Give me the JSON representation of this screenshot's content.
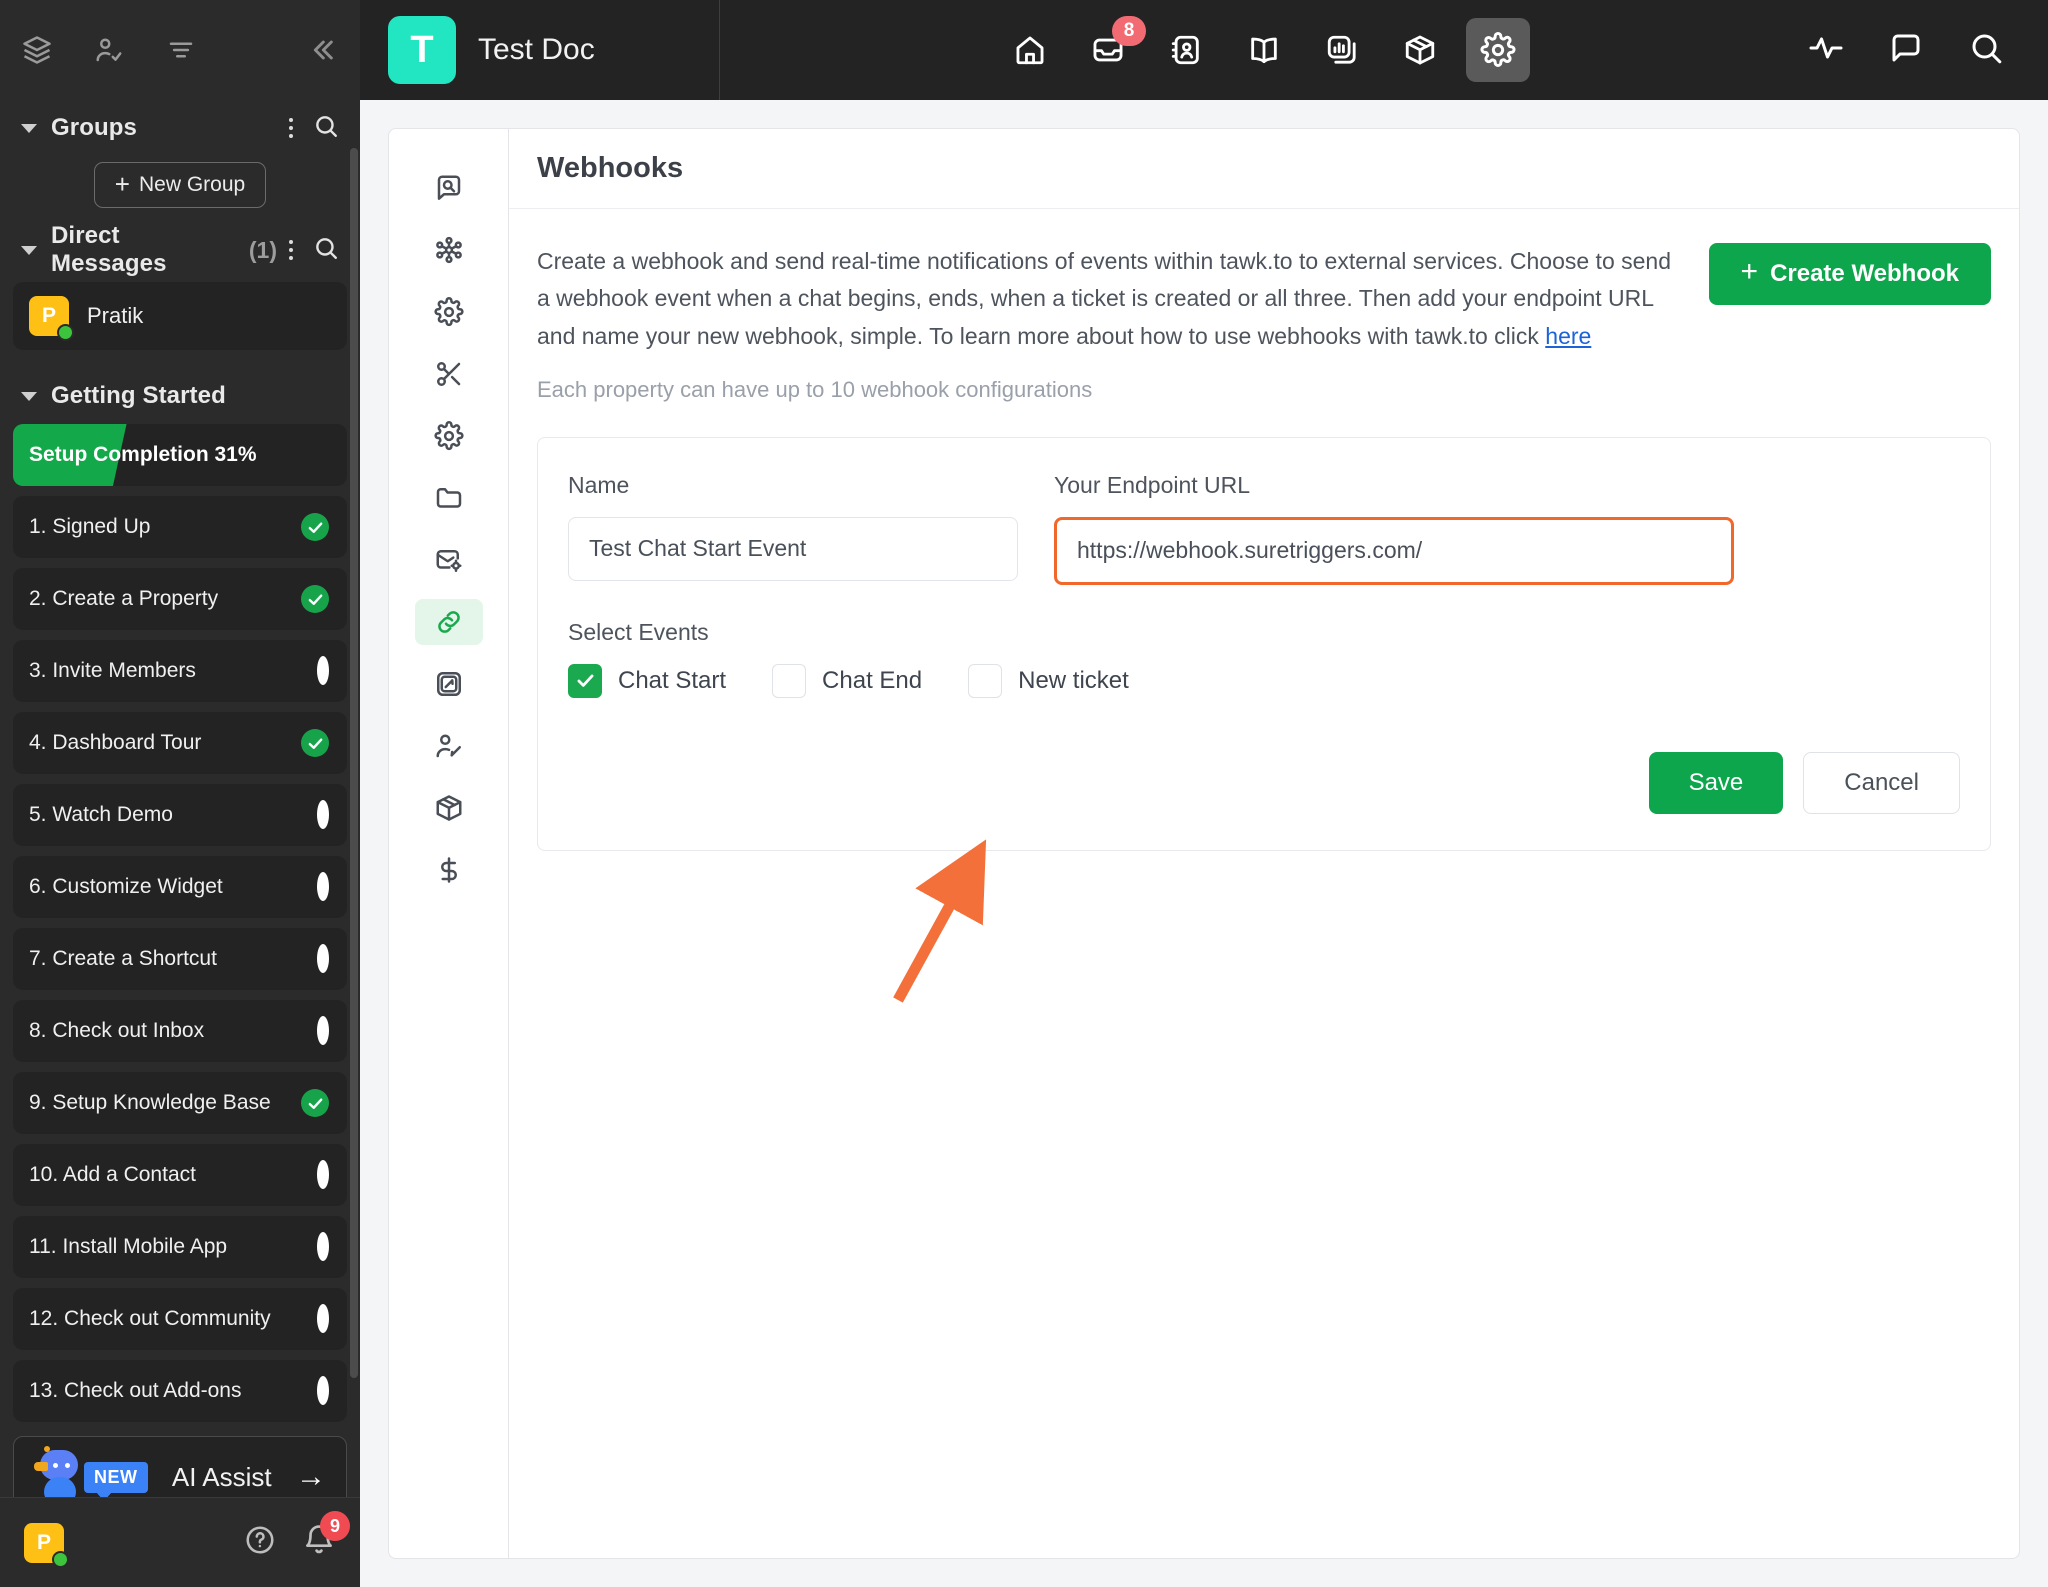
{
  "sidebar": {
    "toolbar_icons": [
      "layers-icon",
      "user-check-icon",
      "filter-icon"
    ],
    "collapse_icon": "chevrons-left-icon",
    "groups": {
      "title": "Groups",
      "menu_icon": "more-vertical-icon",
      "search_icon": "search-icon",
      "new_group_label": "New Group"
    },
    "direct_messages": {
      "title": "Direct Messages",
      "count": "(1)",
      "menu_icon": "more-vertical-icon",
      "search_icon": "search-icon",
      "items": [
        {
          "name": "Pratik",
          "initial": "P",
          "status": "online"
        }
      ]
    },
    "getting_started": {
      "title": "Getting Started",
      "progress_label": "Setup Completion 31%",
      "progress_percent": 31,
      "items": [
        {
          "label": "1. Signed Up",
          "done": true
        },
        {
          "label": "2. Create a Property",
          "done": true
        },
        {
          "label": "3. Invite Members",
          "done": false
        },
        {
          "label": "4. Dashboard Tour",
          "done": true
        },
        {
          "label": "5. Watch Demo",
          "done": false
        },
        {
          "label": "6. Customize Widget",
          "done": false
        },
        {
          "label": "7. Create a Shortcut",
          "done": false
        },
        {
          "label": "8. Check out Inbox",
          "done": false
        },
        {
          "label": "9. Setup Knowledge Base",
          "done": true
        },
        {
          "label": "10. Add a Contact",
          "done": false
        },
        {
          "label": "11. Install Mobile App",
          "done": false
        },
        {
          "label": "12. Check out Community",
          "done": false
        },
        {
          "label": "13. Check out Add-ons",
          "done": false
        }
      ]
    },
    "ai_assist": {
      "badge": "NEW",
      "label": "AI Assist",
      "arrow_icon": "arrow-right-icon"
    },
    "bottom": {
      "avatar_initial": "P",
      "help_icon": "help-circle-icon",
      "bell_icon": "bell-icon",
      "bell_count": "9"
    }
  },
  "topbar": {
    "brand_initial": "T",
    "brand_name": "Test Doc",
    "nav": [
      {
        "icon": "home-icon",
        "active": false,
        "badge": ""
      },
      {
        "icon": "inbox-icon",
        "active": false,
        "badge": "8"
      },
      {
        "icon": "contacts-icon",
        "active": false,
        "badge": ""
      },
      {
        "icon": "knowledge-base-icon",
        "active": false,
        "badge": ""
      },
      {
        "icon": "reports-icon",
        "active": false,
        "badge": ""
      },
      {
        "icon": "addons-icon",
        "active": false,
        "badge": ""
      },
      {
        "icon": "gear-icon",
        "active": true,
        "badge": ""
      }
    ],
    "right_icons": [
      "monitoring-icon",
      "chat-icon",
      "search-icon"
    ]
  },
  "icon_rail": [
    {
      "icon": "property-overview-icon",
      "active": false
    },
    {
      "icon": "widget-icon",
      "active": false
    },
    {
      "icon": "chat-settings-icon",
      "active": false
    },
    {
      "icon": "shortcuts-icon",
      "active": false
    },
    {
      "icon": "settings-gear-icon",
      "active": false
    },
    {
      "icon": "folder-icon",
      "active": false
    },
    {
      "icon": "mail-settings-icon",
      "active": false
    },
    {
      "icon": "webhooks-link-icon",
      "active": true
    },
    {
      "icon": "javascript-api-icon",
      "active": false
    },
    {
      "icon": "property-members-icon",
      "active": false
    },
    {
      "icon": "addons-box-icon",
      "active": false
    },
    {
      "icon": "billing-dollar-icon",
      "active": false
    }
  ],
  "panel": {
    "title": "Webhooks",
    "description_part1": "Create a webhook and send real-time notifications of events within tawk.to to external services. Choose to send a webhook event when a chat begins, ends, when a ticket is created or all three. Then add your endpoint URL and name your new webhook, simple. To learn more about how to use webhooks with tawk.to click ",
    "description_link": "here",
    "note": "Each property can have up to 10 webhook configurations",
    "create_button": "Create Webhook"
  },
  "form": {
    "name_label": "Name",
    "name_value": "Test Chat Start Event",
    "name_placeholder": "Name",
    "url_label": "Your Endpoint URL",
    "url_value": "https://webhook.suretriggers.com/",
    "url_placeholder": "https://",
    "events_label": "Select Events",
    "events": [
      {
        "label": "Chat Start",
        "checked": true
      },
      {
        "label": "Chat End",
        "checked": false
      },
      {
        "label": "New ticket",
        "checked": false
      }
    ],
    "save_label": "Save",
    "cancel_label": "Cancel"
  },
  "annotation": {
    "type": "arrow",
    "color": "#f4703a",
    "points_to": "chat-start-checkbox"
  },
  "colors": {
    "accent_green": "#0ea64c",
    "brand_teal": "#21e6c1",
    "highlight_orange": "#f2682a",
    "badge_red": "#f26b73",
    "avatar_yellow": "#ffc016",
    "sidebar_bg": "#2b2b2b"
  }
}
